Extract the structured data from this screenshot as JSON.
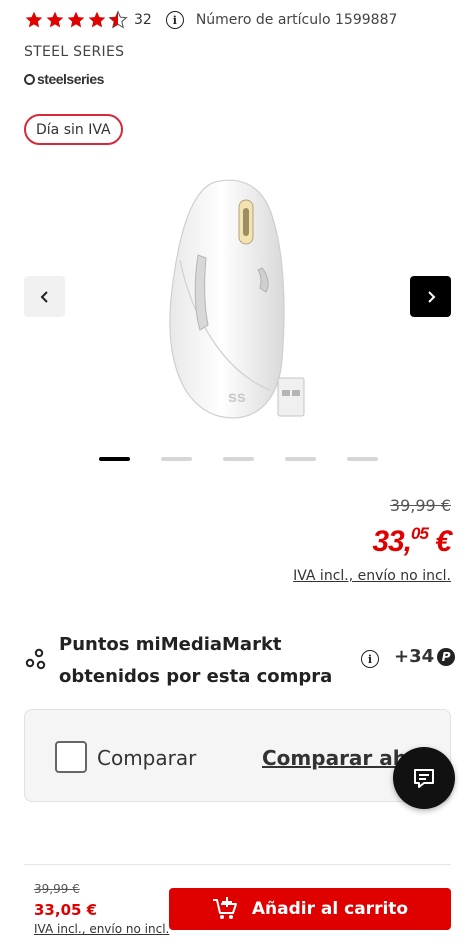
{
  "rating": {
    "value": 4.5,
    "max": 5,
    "count": "32",
    "star_color": "#df0000"
  },
  "article": {
    "text": "Número de artículo 1599887"
  },
  "brand": {
    "name": "STEEL SERIES",
    "logo_text": "steelseries"
  },
  "badge": {
    "label": "Día sin IVA",
    "color": "#d62a3b"
  },
  "gallery": {
    "prev_icon": "chevron-left-icon",
    "next_icon": "chevron-right-icon",
    "image": "white wireless gaming mouse with USB receiver",
    "slide_count": 5,
    "active_slide": 1
  },
  "price": {
    "old": "39,99 €",
    "main": "33,",
    "cents": "05",
    "currency": " €",
    "note": "IVA incl., envío no incl."
  },
  "points": {
    "text": "Puntos miMediaMarkt obtenidos por esta compra",
    "value": "+34",
    "badge": "P"
  },
  "compare": {
    "label": "Comparar",
    "link": "Comparar ahora"
  },
  "sticky": {
    "old_price": "39,99 €",
    "new_price": "33,05 €",
    "note": "IVA incl., envío no incl.",
    "cart_label": "Añadir al carrito",
    "cart_color": "#df0000"
  }
}
